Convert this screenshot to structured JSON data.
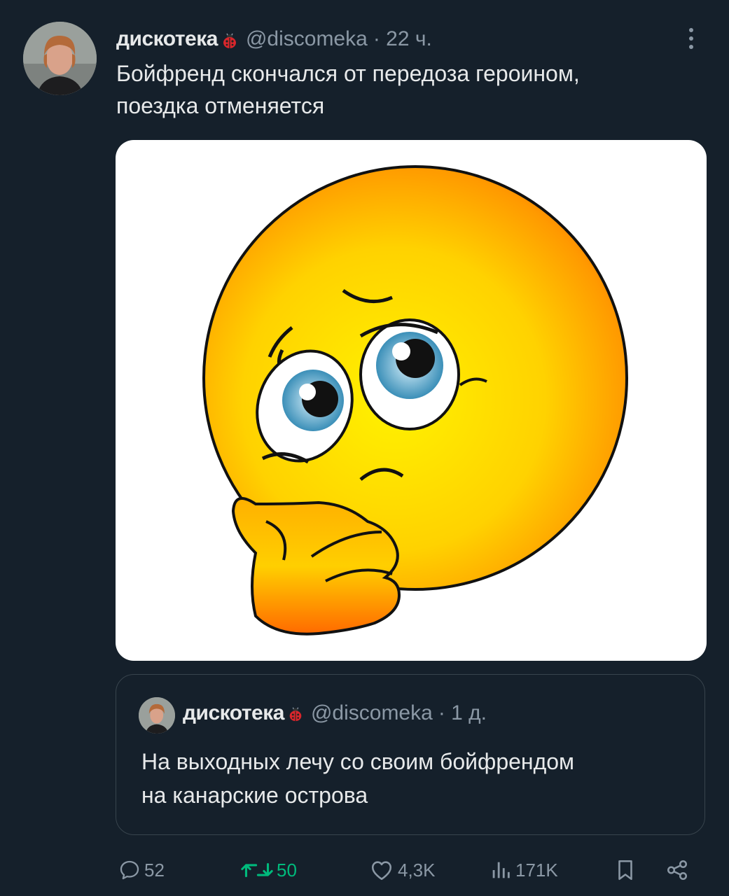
{
  "tweet": {
    "author_name": "дискотека",
    "author_handle": "@discomeka",
    "time": "· 22 ч.",
    "text_line1": "Бойфренд скончался от передоза героином,",
    "text_line2": "поездка отменяется",
    "media_icon": "crying-emoji-image"
  },
  "quote": {
    "author_name": "дискотека",
    "author_handle": "@discomeka",
    "time": "· 1 д.",
    "text_line1": "На выходных лечу со своим бойфрендом",
    "text_line2": "на канарские острова"
  },
  "actions": {
    "replies": "52",
    "retweets": "50",
    "likes": "4,3K",
    "views": "171K"
  },
  "colors": {
    "background": "#15202b",
    "text": "#e7e9ea",
    "muted": "#8b98a5",
    "retweet_active": "#00ba7c"
  }
}
